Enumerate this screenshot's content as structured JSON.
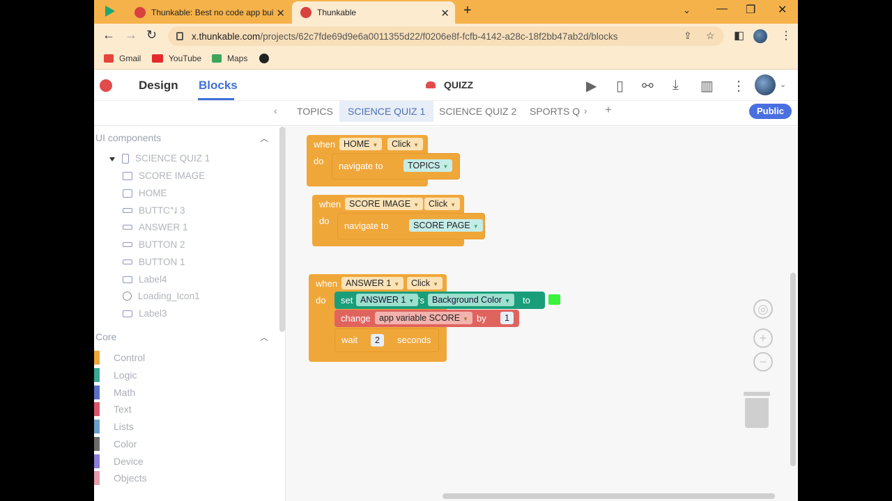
{
  "browser": {
    "tabs": [
      {
        "title": "Thunkable: Best no code app bui"
      },
      {
        "title": "Thunkable"
      }
    ],
    "url_host": "x.thunkable.com",
    "url_path": "/projects/62c7fde69d9e6a0011355d22/f0206e8f-fcfb-4142-a28c-18f2bb47ab2d/blocks",
    "bookmarks": [
      "Gmail",
      "YouTube",
      "Maps"
    ]
  },
  "app": {
    "design_tab": "Design",
    "blocks_tab": "Blocks",
    "project_name": "QUIZZ",
    "screen_tabs": [
      "TOPICS",
      "SCIENCE QUIZ 1",
      "SCIENCE QUIZ 2",
      "SPORTS Q"
    ],
    "public_label": "Public"
  },
  "left": {
    "ui_header": "UI components",
    "screen": "SCIENCE QUIZ 1",
    "components": [
      {
        "label": "SCORE IMAGE",
        "icon": "image-icon"
      },
      {
        "label": "HOME",
        "icon": "image-icon"
      },
      {
        "label": "BUTTON 3",
        "icon": "button-icon"
      },
      {
        "label": "ANSWER 1",
        "icon": "button-icon"
      },
      {
        "label": "BUTTON 2",
        "icon": "button-icon"
      },
      {
        "label": "BUTTON 1",
        "icon": "button-icon"
      },
      {
        "label": "Label4",
        "icon": "label-icon"
      },
      {
        "label": "Loading_Icon1",
        "icon": "spinner-icon"
      },
      {
        "label": "Label3",
        "icon": "label-icon"
      }
    ],
    "core_header": "Core",
    "categories": [
      {
        "label": "Control",
        "color": "#f0a73a"
      },
      {
        "label": "Logic",
        "color": "#3aa892"
      },
      {
        "label": "Math",
        "color": "#5b6fc4"
      },
      {
        "label": "Text",
        "color": "#d9566a"
      },
      {
        "label": "Lists",
        "color": "#6c9fc8"
      },
      {
        "label": "Color",
        "color": "#6b6b6b"
      },
      {
        "label": "Device",
        "color": "#8b7fd6"
      },
      {
        "label": "Objects",
        "color": "#e79aa8"
      }
    ]
  },
  "blocks": {
    "b1": {
      "when": "when",
      "component": "HOME",
      "event": "Click",
      "do": "do",
      "action": "navigate to",
      "target": "TOPICS"
    },
    "b2": {
      "when": "when",
      "component": "SCORE IMAGE",
      "event": "Click",
      "do": "do",
      "action": "navigate to",
      "target": "SCORE PAGE"
    },
    "b3": {
      "when": "when",
      "component": "ANSWER 1",
      "event": "Click",
      "do": "do",
      "set": "set",
      "set_component": "ANSWER 1",
      "possessive": "'s",
      "property": "Background Color",
      "to": "to",
      "swatch_color": "#39f23c",
      "change": "change",
      "variable": "app variable SCORE",
      "by": "by",
      "by_value": "1",
      "wait": "wait",
      "wait_value": "2",
      "seconds": "seconds"
    }
  }
}
